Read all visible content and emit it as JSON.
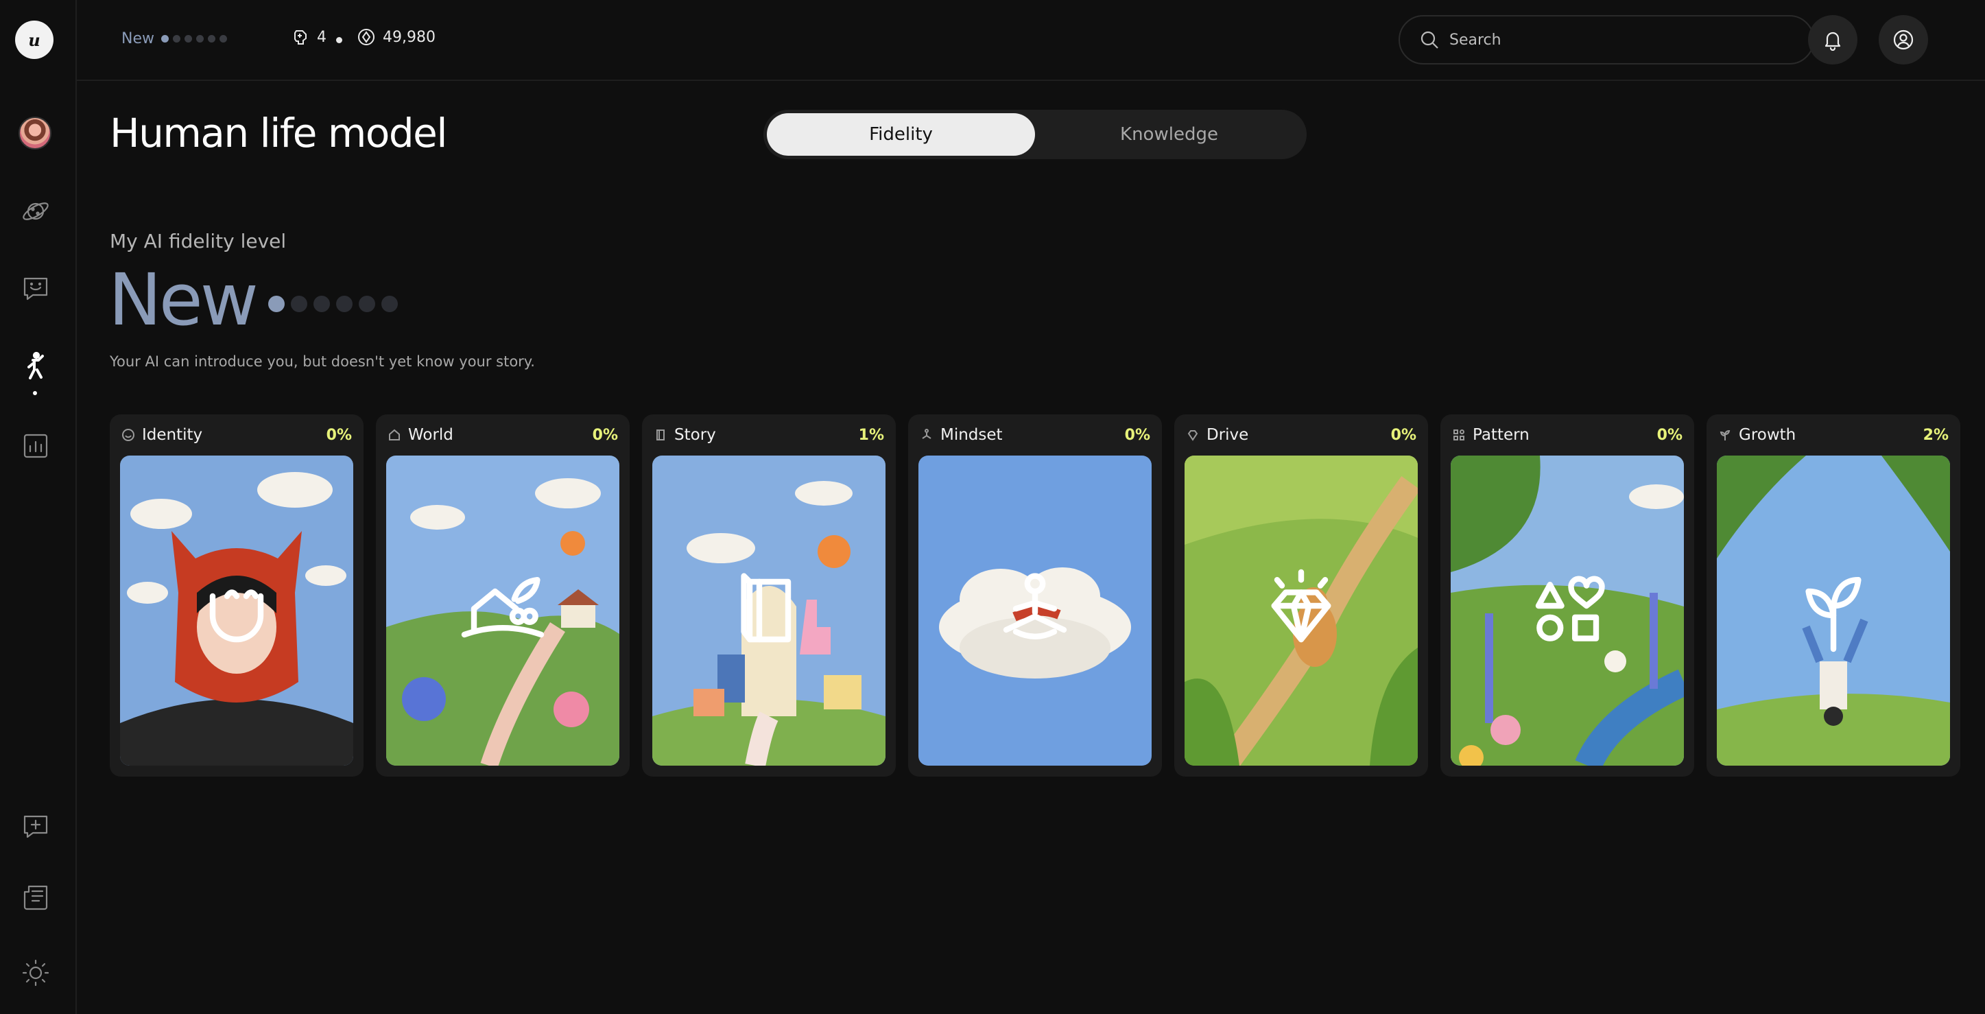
{
  "app": {
    "logo_text": "u"
  },
  "topbar": {
    "level_label": "New",
    "level_dots_total": 6,
    "level_dots_filled": 1,
    "memories_count": "4",
    "points": "49,980",
    "search_placeholder": "Search"
  },
  "sidebar": {
    "items": [
      {
        "name": "avatar"
      },
      {
        "name": "explore",
        "icon": "planet-icon"
      },
      {
        "name": "chat",
        "icon": "chat-smile-icon"
      },
      {
        "name": "life-model",
        "icon": "person-icon",
        "active": true
      },
      {
        "name": "stats",
        "icon": "chart-icon"
      },
      {
        "name": "new-chat",
        "icon": "chat-plus-icon"
      },
      {
        "name": "news",
        "icon": "newspaper-icon"
      },
      {
        "name": "theme",
        "icon": "sun-icon"
      }
    ]
  },
  "main": {
    "title": "Human life model",
    "tabs": [
      {
        "label": "Fidelity",
        "active": true
      },
      {
        "label": "Knowledge",
        "active": false
      }
    ],
    "fidelity_label": "My AI fidelity level",
    "level_name": "New",
    "level_dots_total": 6,
    "level_dots_filled": 1,
    "description": "Your AI can introduce you, but doesn't yet know your story."
  },
  "colors": {
    "accent_level": "#8a9bb8",
    "percent": "#e7f27a",
    "background": "#0f0f0f",
    "card": "#1c1c1c"
  },
  "cards": [
    {
      "name": "Identity",
      "percent": "0%",
      "icon": "smile-icon"
    },
    {
      "name": "World",
      "percent": "0%",
      "icon": "house-icon"
    },
    {
      "name": "Story",
      "percent": "1%",
      "icon": "book-icon"
    },
    {
      "name": "Mindset",
      "percent": "0%",
      "icon": "meditation-icon"
    },
    {
      "name": "Drive",
      "percent": "0%",
      "icon": "diamond-icon"
    },
    {
      "name": "Pattern",
      "percent": "0%",
      "icon": "shapes-icon"
    },
    {
      "name": "Growth",
      "percent": "2%",
      "icon": "sprout-icon"
    }
  ]
}
